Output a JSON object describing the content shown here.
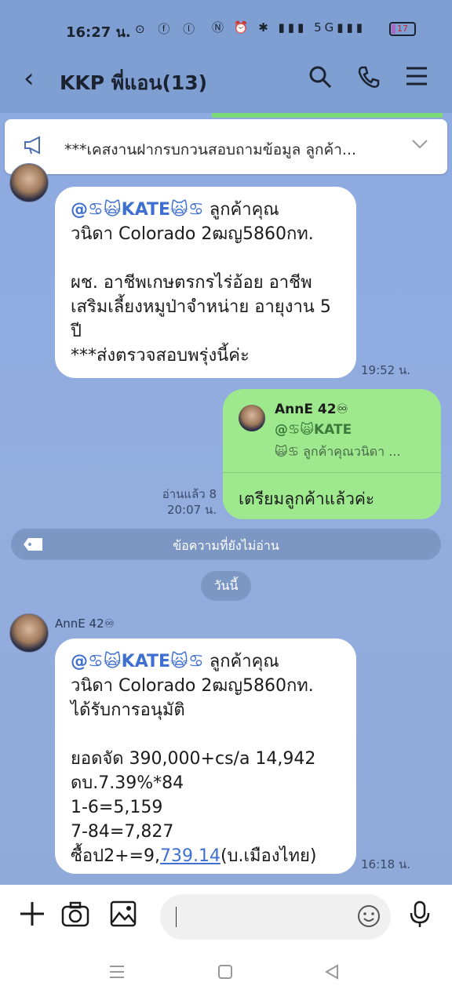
{
  "status_bar": {
    "time": "16:27 น.",
    "left_icons": "⊙ ⓕ ⓛ",
    "right_icons": "Ⓝ ⏰ ✱ ▮▮▮ 5G▮▮▮",
    "battery": "17"
  },
  "header": {
    "back_icon": "‹",
    "title": "KKP พี่แอน(13)",
    "search_icon": "⚲",
    "call_icon": "✆",
    "menu_icon": "☰"
  },
  "announcement": {
    "icon": "📢",
    "text": "***เคสงานฝากรบกวนสอบถามข้อมูล ลูกค้า...",
    "chevron": "⌄"
  },
  "messages": [
    {
      "sender": "AnnE 42",
      "lines": [
        "@♋🙀KATE🙀♋ ลูกค้าคุณ",
        "วนิดา Colorado 2ฒญ5860กท.",
        "",
        "ผช. อาชีพเกษตรกรไร่อ้อย อาชีพ",
        "เสริมเลี้ยงหมูป่าจำหน่าย อายุงาน 5",
        "ปี",
        "***ส่งตรวจสอบพรุ่งนี้ค่ะ"
      ],
      "time": "19:52 น."
    }
  ],
  "my_reply": {
    "quote_name": "AnnE 42♾",
    "quote_mention": "@♋🙀KATE",
    "quote_text": "🙀♋ ลูกค้าคุณวนิดา ...",
    "reply_text": "เตรียมลูกค้าแล้วค่ะ",
    "read_status": "อ่านแล้ว 8",
    "time": "20:07 น."
  },
  "unread_divider": "ข้อความที่ยังไม่อ่าน",
  "day_chip": "วันนี้",
  "latest_message": {
    "sender": "AnnE 42♾",
    "mention": "@♋🙀KATE🙀♋",
    "line1_rest": " ลูกค้าคุณ",
    "line2": "วนิดา Colorado 2ฒญ5860กท.",
    "line3": "ได้รับการอนุมัติ",
    "line5": "ยอดจัด 390,000+cs/a 14,942",
    "line6": "ดบ.7.39%*84",
    "line7": "1-6=5,159",
    "line8": "7-84=7,827",
    "line9_prefix": "ซื้อป2+=9,",
    "line9_link": "739.14",
    "line9_suffix": "(บ.เมืองไทย)",
    "time": "16:18 น."
  },
  "bottom_bar": {
    "plus_icon": "+",
    "camera_icon": "📷",
    "image_icon": "🖼",
    "emoji_icon": "☺",
    "mic_icon": "🎤"
  },
  "nav": {
    "recent": "☰",
    "home": "▢",
    "back": "◁"
  }
}
